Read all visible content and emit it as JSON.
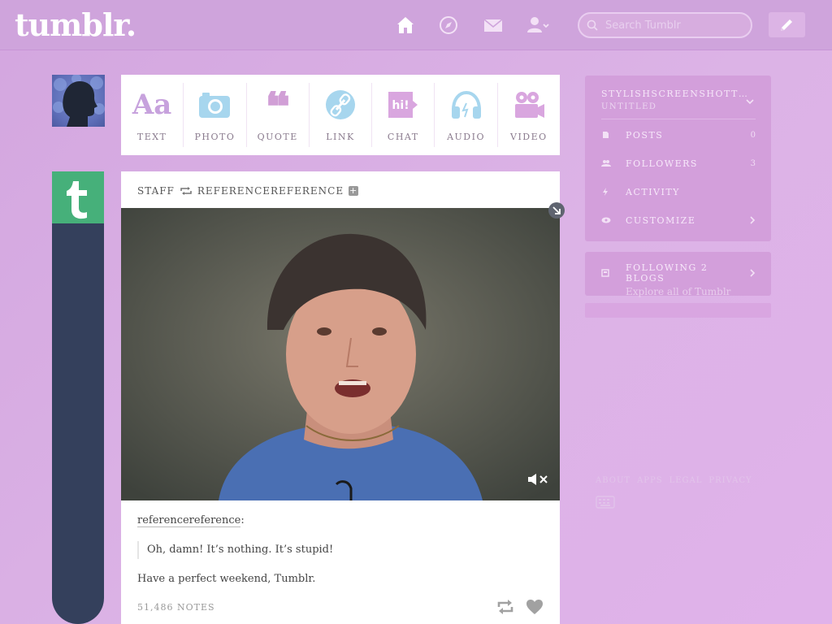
{
  "header": {
    "logo": "tumblr.",
    "search_placeholder": "Search Tumblr",
    "nav": [
      "home-icon",
      "explore-icon",
      "inbox-icon",
      "account-icon"
    ]
  },
  "post_types": [
    {
      "label": "TEXT",
      "icon": "text-icon"
    },
    {
      "label": "PHOTO",
      "icon": "camera-icon"
    },
    {
      "label": "QUOTE",
      "icon": "quote-icon"
    },
    {
      "label": "LINK",
      "icon": "link-icon"
    },
    {
      "label": "CHAT",
      "icon": "chat-icon"
    },
    {
      "label": "AUDIO",
      "icon": "headphones-icon"
    },
    {
      "label": "VIDEO",
      "icon": "video-camera-icon"
    }
  ],
  "post": {
    "author": "STAFF",
    "reblogged_from": "REFERENCEREFERENCE",
    "source": "referencereference",
    "quote": "Oh, damn! It’s nothing. It’s stupid!",
    "body": "Have a perfect weekend, Tumblr.",
    "notes": "51,486 NOTES"
  },
  "sidebar": {
    "blog_name": "STYLISHSCREENSHOTT…",
    "blog_subtitle": "UNTITLED",
    "rows": [
      {
        "label": "POSTS",
        "value": "0"
      },
      {
        "label": "FOLLOWERS",
        "value": "3"
      },
      {
        "label": "ACTIVITY",
        "value": ""
      },
      {
        "label": "CUSTOMIZE",
        "value": ""
      }
    ],
    "following": "FOLLOWING 2 BLOGS",
    "explore": "Explore all of Tumblr",
    "footer": [
      "ABOUT",
      "APPS",
      "LEGAL",
      "PRIVACY"
    ]
  },
  "colors": {
    "background": "#d3a6df",
    "staff_avatar": "#46b07a",
    "rail": "#34405c"
  }
}
